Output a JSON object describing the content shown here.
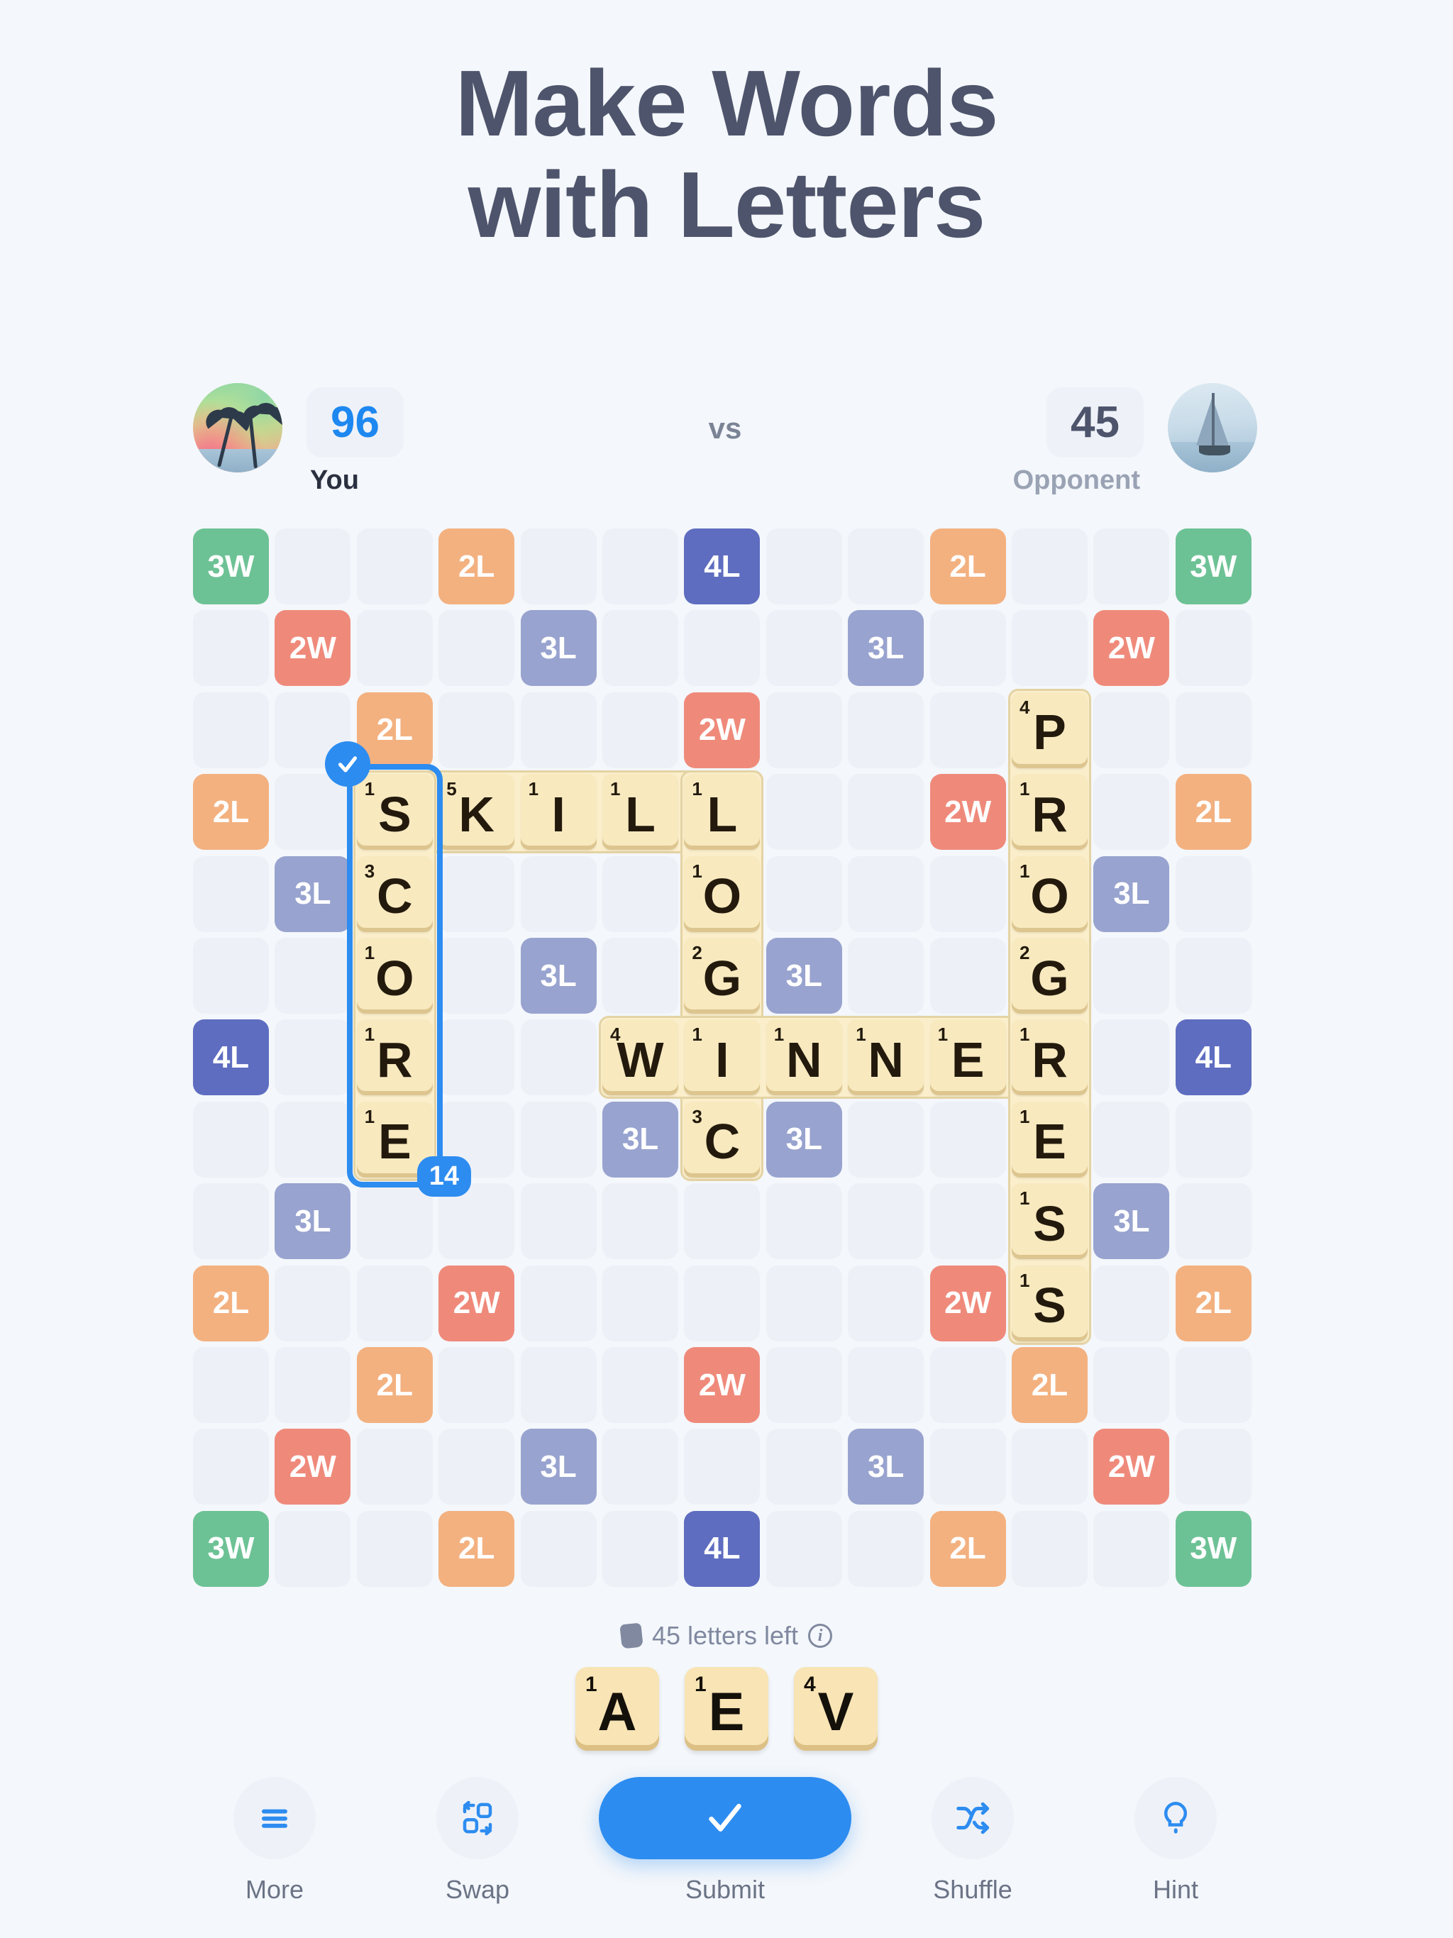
{
  "header": {
    "title_line1": "Make Words",
    "title_line2": "with Letters"
  },
  "scoreboard": {
    "my_score": "96",
    "my_name": "You",
    "vs_label": "vs",
    "opponent_score": "45",
    "opponent_name": "Opponent",
    "my_avatar_icon": "tropical-beach-avatar",
    "opponent_avatar_icon": "sailboat-avatar"
  },
  "board": {
    "rows": 13,
    "cols": 13,
    "bonus_legend": {
      "2L": "2L",
      "3L": "3L",
      "4L": "4L",
      "2W": "2W",
      "3W": "3W"
    },
    "bonuses": [
      {
        "r": 0,
        "c": 0,
        "type": "3W",
        "label": "3W"
      },
      {
        "r": 0,
        "c": 3,
        "type": "2L",
        "label": "2L"
      },
      {
        "r": 0,
        "c": 6,
        "type": "4L",
        "label": "4L"
      },
      {
        "r": 0,
        "c": 9,
        "type": "2L",
        "label": "2L"
      },
      {
        "r": 0,
        "c": 12,
        "type": "3W",
        "label": "3W"
      },
      {
        "r": 1,
        "c": 1,
        "type": "2W",
        "label": "2W"
      },
      {
        "r": 1,
        "c": 4,
        "type": "3L",
        "label": "3L"
      },
      {
        "r": 1,
        "c": 8,
        "type": "3L",
        "label": "3L"
      },
      {
        "r": 1,
        "c": 11,
        "type": "2W",
        "label": "2W"
      },
      {
        "r": 2,
        "c": 2,
        "type": "2L",
        "label": "2L"
      },
      {
        "r": 2,
        "c": 6,
        "type": "2W",
        "label": "2W"
      },
      {
        "r": 3,
        "c": 0,
        "type": "2L",
        "label": "2L"
      },
      {
        "r": 3,
        "c": 9,
        "type": "2W",
        "label": "2W"
      },
      {
        "r": 3,
        "c": 12,
        "type": "2L",
        "label": "2L"
      },
      {
        "r": 4,
        "c": 1,
        "type": "3L",
        "label": "3L"
      },
      {
        "r": 4,
        "c": 11,
        "type": "3L",
        "label": "3L"
      },
      {
        "r": 5,
        "c": 4,
        "type": "3L",
        "label": "3L"
      },
      {
        "r": 5,
        "c": 7,
        "type": "3L",
        "label": "3L"
      },
      {
        "r": 6,
        "c": 0,
        "type": "4L",
        "label": "4L"
      },
      {
        "r": 6,
        "c": 12,
        "type": "4L",
        "label": "4L"
      },
      {
        "r": 7,
        "c": 5,
        "type": "3L",
        "label": "3L"
      },
      {
        "r": 7,
        "c": 7,
        "type": "3L",
        "label": "3L"
      },
      {
        "r": 8,
        "c": 1,
        "type": "3L",
        "label": "3L"
      },
      {
        "r": 8,
        "c": 11,
        "type": "3L",
        "label": "3L"
      },
      {
        "r": 9,
        "c": 0,
        "type": "2L",
        "label": "2L"
      },
      {
        "r": 9,
        "c": 3,
        "type": "2W",
        "label": "2W"
      },
      {
        "r": 9,
        "c": 9,
        "type": "2W",
        "label": "2W"
      },
      {
        "r": 9,
        "c": 12,
        "type": "2L",
        "label": "2L"
      },
      {
        "r": 10,
        "c": 2,
        "type": "2L",
        "label": "2L"
      },
      {
        "r": 10,
        "c": 6,
        "type": "2W",
        "label": "2W"
      },
      {
        "r": 10,
        "c": 10,
        "type": "2L",
        "label": "2L"
      },
      {
        "r": 11,
        "c": 1,
        "type": "2W",
        "label": "2W"
      },
      {
        "r": 11,
        "c": 4,
        "type": "3L",
        "label": "3L"
      },
      {
        "r": 11,
        "c": 8,
        "type": "3L",
        "label": "3L"
      },
      {
        "r": 11,
        "c": 11,
        "type": "2W",
        "label": "2W"
      },
      {
        "r": 12,
        "c": 0,
        "type": "3W",
        "label": "3W"
      },
      {
        "r": 12,
        "c": 3,
        "type": "2L",
        "label": "2L"
      },
      {
        "r": 12,
        "c": 6,
        "type": "4L",
        "label": "4L"
      },
      {
        "r": 12,
        "c": 9,
        "type": "2L",
        "label": "2L"
      },
      {
        "r": 12,
        "c": 12,
        "type": "3W",
        "label": "3W"
      }
    ],
    "word_backdrops": [
      {
        "r": 3,
        "c": 2,
        "rows": 1,
        "cols": 5
      },
      {
        "r": 3,
        "c": 6,
        "rows": 5,
        "cols": 1
      },
      {
        "r": 6,
        "c": 5,
        "rows": 1,
        "cols": 6
      },
      {
        "r": 2,
        "c": 10,
        "rows": 8,
        "cols": 1
      },
      {
        "r": 3,
        "c": 2,
        "rows": 5,
        "cols": 1
      }
    ],
    "tiles": [
      {
        "r": 3,
        "c": 2,
        "letter": "S",
        "points": "1"
      },
      {
        "r": 3,
        "c": 3,
        "letter": "K",
        "points": "5"
      },
      {
        "r": 3,
        "c": 4,
        "letter": "I",
        "points": "1"
      },
      {
        "r": 3,
        "c": 5,
        "letter": "L",
        "points": "1"
      },
      {
        "r": 3,
        "c": 6,
        "letter": "L",
        "points": "1"
      },
      {
        "r": 4,
        "c": 2,
        "letter": "C",
        "points": "3"
      },
      {
        "r": 4,
        "c": 6,
        "letter": "O",
        "points": "1"
      },
      {
        "r": 5,
        "c": 2,
        "letter": "O",
        "points": "1"
      },
      {
        "r": 5,
        "c": 6,
        "letter": "G",
        "points": "2"
      },
      {
        "r": 6,
        "c": 2,
        "letter": "R",
        "points": "1"
      },
      {
        "r": 6,
        "c": 5,
        "letter": "W",
        "points": "4"
      },
      {
        "r": 6,
        "c": 6,
        "letter": "I",
        "points": "1"
      },
      {
        "r": 6,
        "c": 7,
        "letter": "N",
        "points": "1"
      },
      {
        "r": 6,
        "c": 8,
        "letter": "N",
        "points": "1"
      },
      {
        "r": 6,
        "c": 9,
        "letter": "E",
        "points": "1"
      },
      {
        "r": 6,
        "c": 10,
        "letter": "R",
        "points": "1"
      },
      {
        "r": 7,
        "c": 2,
        "letter": "E",
        "points": "1"
      },
      {
        "r": 7,
        "c": 6,
        "letter": "C",
        "points": "3"
      },
      {
        "r": 2,
        "c": 10,
        "letter": "P",
        "points": "4"
      },
      {
        "r": 3,
        "c": 10,
        "letter": "R",
        "points": "1"
      },
      {
        "r": 4,
        "c": 10,
        "letter": "O",
        "points": "1"
      },
      {
        "r": 5,
        "c": 10,
        "letter": "G",
        "points": "2"
      },
      {
        "r": 7,
        "c": 10,
        "letter": "E",
        "points": "1"
      },
      {
        "r": 8,
        "c": 10,
        "letter": "S",
        "points": "1"
      },
      {
        "r": 9,
        "c": 10,
        "letter": "S",
        "points": "1"
      }
    ],
    "selection": {
      "r": 3,
      "c": 2,
      "rows": 5,
      "cols": 1,
      "word": "SCORE",
      "score_badge": "14",
      "check_icon": "checkmark-icon"
    },
    "words_on_board": [
      "SKILL",
      "SCORE",
      "LOGIC",
      "WINNER",
      "PROGRESS"
    ]
  },
  "letters_left": {
    "text": "45 letters left",
    "bag_icon": "tile-bag-icon",
    "info_icon": "info-icon"
  },
  "rack": {
    "tiles": [
      {
        "letter": "A",
        "points": "1"
      },
      {
        "letter": "E",
        "points": "1"
      },
      {
        "letter": "V",
        "points": "4"
      }
    ]
  },
  "toolbar": {
    "more_label": "More",
    "swap_label": "Swap",
    "submit_label": "Submit",
    "shuffle_label": "Shuffle",
    "hint_label": "Hint",
    "more_icon": "hamburger-menu-icon",
    "swap_icon": "swap-tiles-icon",
    "submit_icon": "checkmark-icon",
    "shuffle_icon": "shuffle-icon",
    "hint_icon": "lightbulb-icon"
  },
  "colors": {
    "accent": "#2d8cf0",
    "bg": "#f4f7fb",
    "title": "#4e546b",
    "bonus_2l": "#f3b180",
    "bonus_3l": "#98a3cf",
    "bonus_4l": "#5e6dc0",
    "bonus_2w": "#ef8a7b",
    "bonus_3w": "#6dc295",
    "tile": "#f8e9bf"
  }
}
